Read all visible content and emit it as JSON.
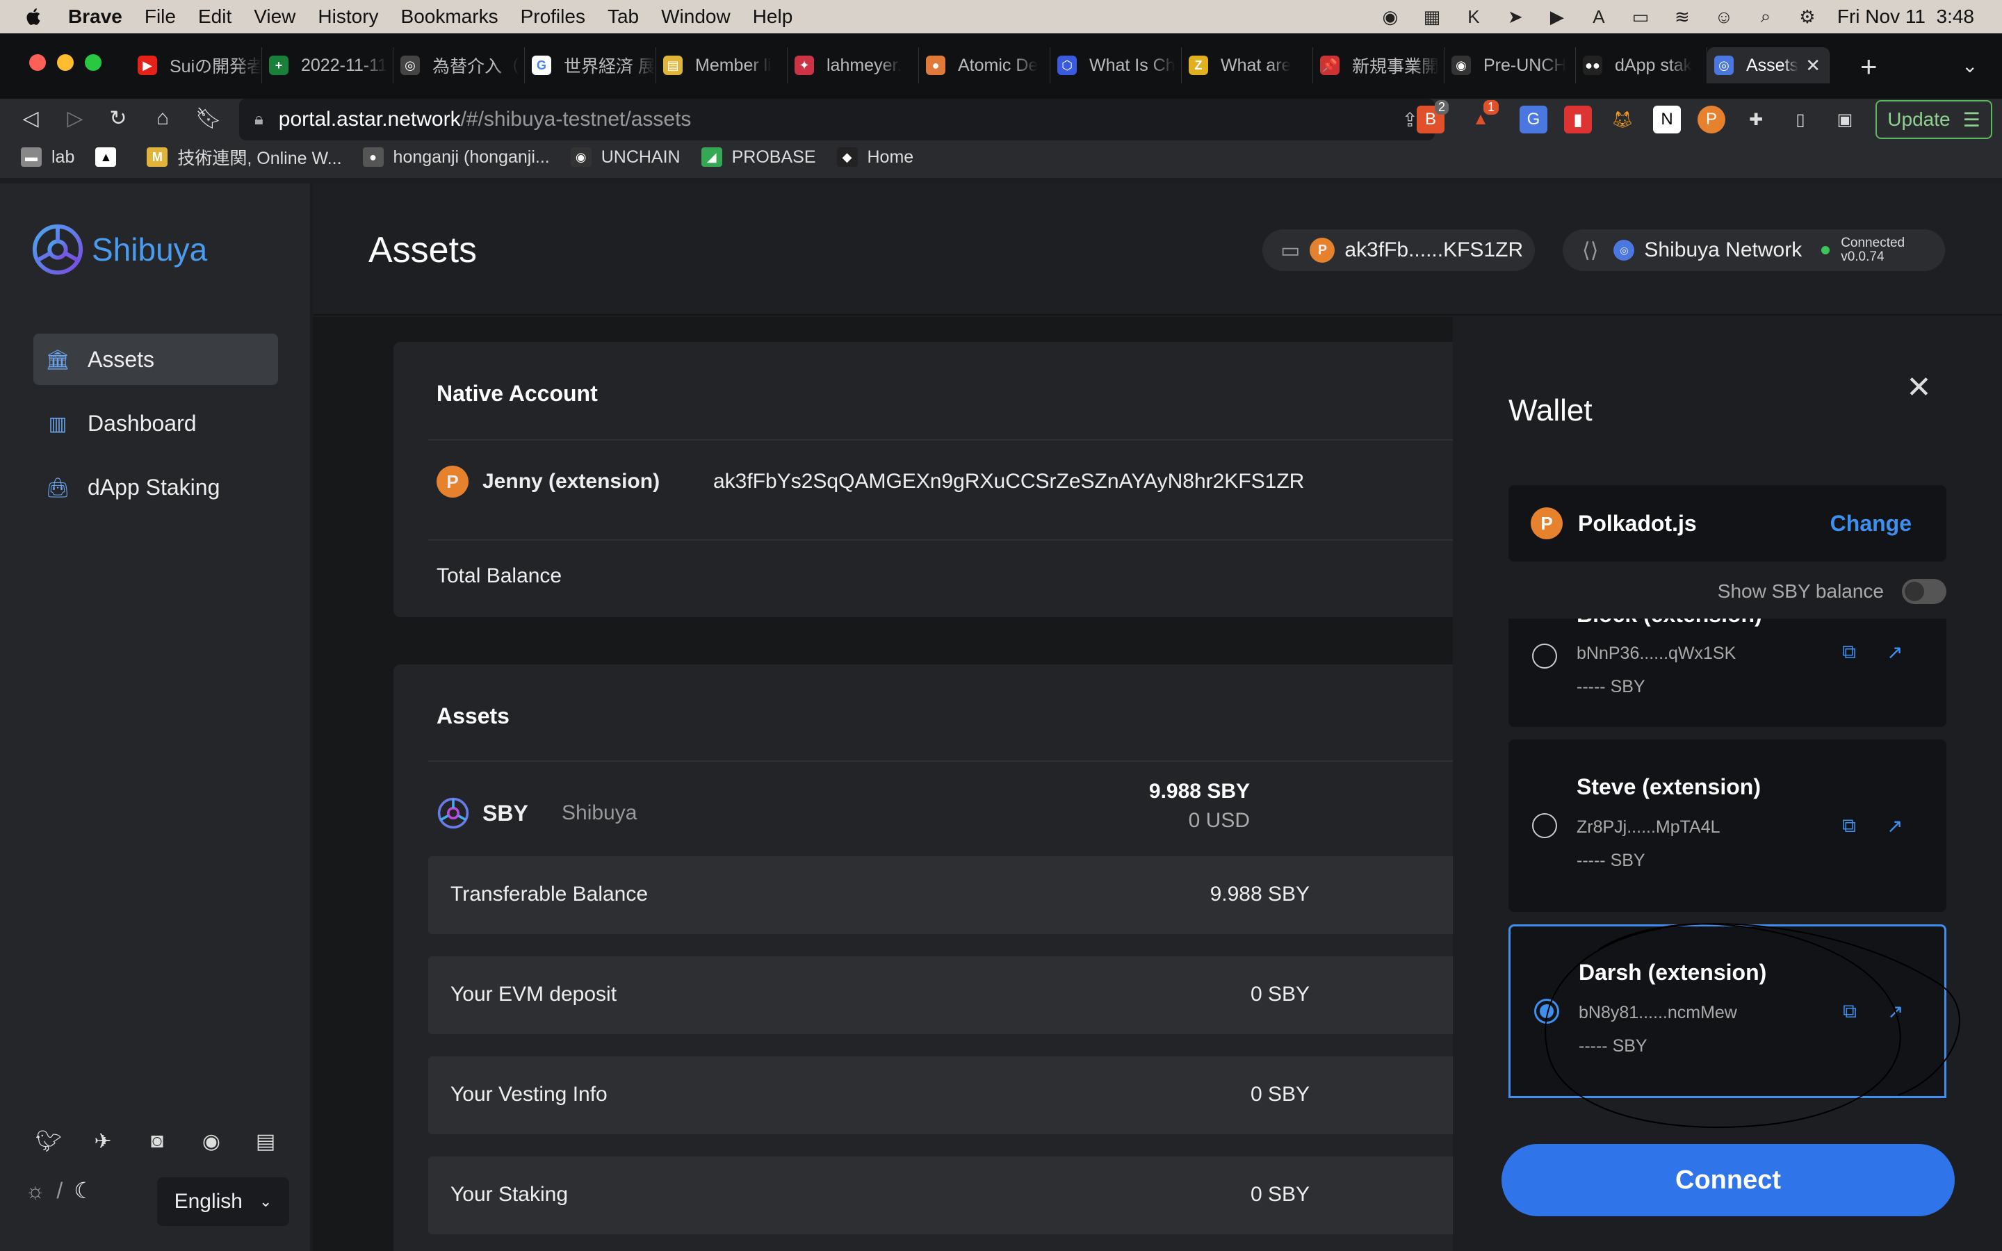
{
  "menubar": {
    "app": "Brave",
    "items": [
      "File",
      "Edit",
      "View",
      "History",
      "Bookmarks",
      "Profiles",
      "Tab",
      "Window",
      "Help"
    ],
    "datetime": "Fri Nov 11  3:48"
  },
  "tabs": [
    {
      "title": "Suiの開発者",
      "color": "#e62117",
      "glyph": "▶"
    },
    {
      "title": "2022-11-11",
      "color": "#188038",
      "glyph": "+"
    },
    {
      "title": "為替介入（",
      "color": "#444444",
      "glyph": "◎"
    },
    {
      "title": "世界経済 展",
      "color": "#ffffff",
      "glyph": "G"
    },
    {
      "title": "Member li",
      "color": "#e0b43a",
      "glyph": "▤"
    },
    {
      "title": "lahmeyer.",
      "color": "#cc3344",
      "glyph": "✦"
    },
    {
      "title": "Atomic De",
      "color": "#e07a3a",
      "glyph": "●"
    },
    {
      "title": "What Is Ch",
      "color": "#3a5ae0",
      "glyph": "⬡"
    },
    {
      "title": "What are ",
      "color": "#e0b020",
      "glyph": "Z"
    },
    {
      "title": "新規事業開",
      "color": "#cc3333",
      "glyph": "📌"
    },
    {
      "title": "Pre-UNCH",
      "color": "#333333",
      "glyph": "◉"
    },
    {
      "title": "dApp stak",
      "color": "#222222",
      "glyph": "●●"
    }
  ],
  "active_tab": {
    "title": "Assets"
  },
  "url": {
    "host": "portal.astar.network",
    "path": "/#/shibuya-testnet/assets"
  },
  "update_label": "Update",
  "badges": {
    "brave": "2",
    "alert": "1"
  },
  "bookmarks": [
    {
      "label": "lab",
      "color": "#888888",
      "glyph": "▬"
    },
    {
      "label": "",
      "color": "#ffffff",
      "glyph": "▲"
    },
    {
      "label": "技術連関, Online W...",
      "color": "#e0b43a",
      "glyph": "M"
    },
    {
      "label": "honganji (honganji...",
      "color": "#555555",
      "glyph": "●"
    },
    {
      "label": "UNCHAIN",
      "color": "#333333",
      "glyph": "◉"
    },
    {
      "label": "PROBASE",
      "color": "#34a853",
      "glyph": "◢"
    },
    {
      "label": "Home",
      "color": "#222222",
      "glyph": "◆"
    }
  ],
  "sidebar": {
    "brand": "Shibuya",
    "items": [
      {
        "label": "Assets",
        "icon": "bank-icon"
      },
      {
        "label": "Dashboard",
        "icon": "chart-icon"
      },
      {
        "label": "dApp Staking",
        "icon": "bag-icon"
      }
    ],
    "language": "English"
  },
  "header": {
    "title": "Assets",
    "account": "ak3fFb......KFS1ZR",
    "network": "Shibuya Network",
    "status": "Connected",
    "version": "v0.0.74"
  },
  "native_account": {
    "title": "Native Account",
    "name": "Jenny (extension)",
    "address": "ak3fFbYs2SqQAMGEXn9gRXuCCSrZeSZnAYAyN8hr2KFS1ZR",
    "total_balance_label": "Total Balance"
  },
  "assets": {
    "title": "Assets",
    "token": "SBY",
    "token_name": "Shibuya",
    "balance": "9.988 SBY",
    "usd": "0 USD",
    "rows": [
      {
        "label": "Transferable Balance",
        "value": "9.988 SBY"
      },
      {
        "label": "Your EVM deposit",
        "value": "0 SBY"
      },
      {
        "label": "Your Vesting Info",
        "value": "0 SBY"
      },
      {
        "label": "Your Staking",
        "value": "0 SBY"
      }
    ]
  },
  "wallet": {
    "title": "Wallet",
    "provider": "Polkadot.js",
    "change_label": "Change",
    "toggle_label": "Show SBY balance",
    "accounts": [
      {
        "name": "Block (extension)",
        "address": "bNnP36......qWx1SK",
        "balance": "----- SBY",
        "selected": false
      },
      {
        "name": "Steve (extension)",
        "address": "Zr8PJj......MpTA4L",
        "balance": "----- SBY",
        "selected": false
      },
      {
        "name": "Darsh (extension)",
        "address": "bN8y81......ncmMew",
        "balance": "----- SBY",
        "selected": true
      }
    ],
    "connect_label": "Connect"
  },
  "colors": {
    "accent": "#2f74e8",
    "link": "#3d8ff0",
    "brand": "#4a9cf0",
    "polkadot": "#e6812e"
  }
}
